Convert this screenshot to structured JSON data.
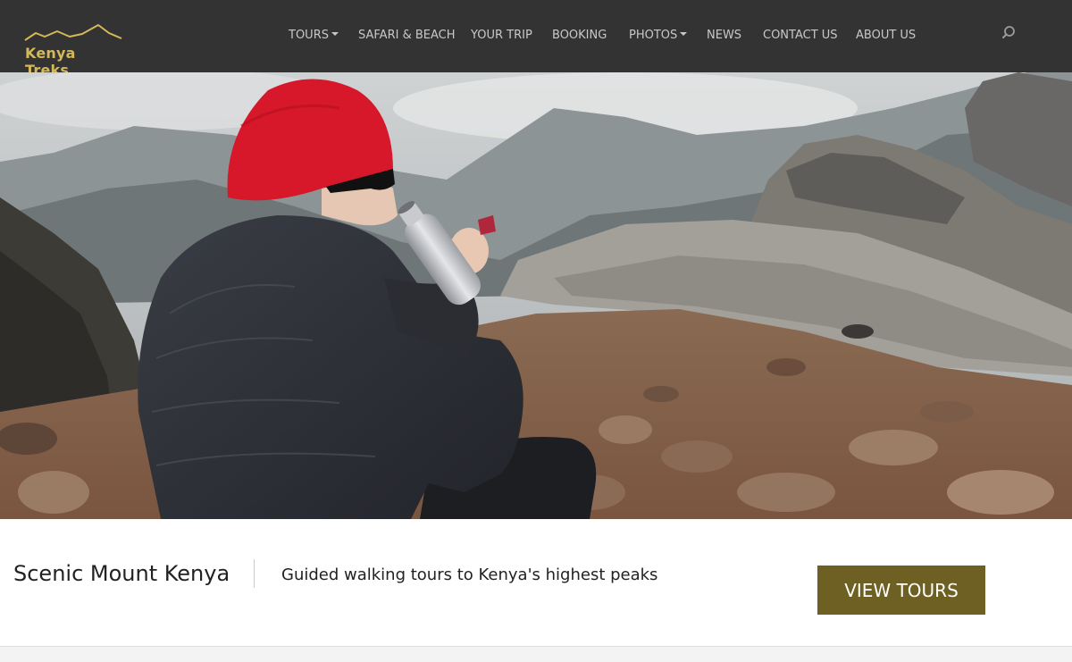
{
  "brand": {
    "name": "Kenya Treks"
  },
  "nav": {
    "items": [
      {
        "label": "TOURS",
        "dropdown": true
      },
      {
        "label": "SAFARI & BEACH",
        "dropdown": false
      },
      {
        "label": "YOUR TRIP",
        "dropdown": false
      },
      {
        "label": "BOOKING",
        "dropdown": false
      },
      {
        "label": "PHOTOS",
        "dropdown": true
      },
      {
        "label": "NEWS",
        "dropdown": false
      },
      {
        "label": "CONTACT US",
        "dropdown": false
      },
      {
        "label": "ABOUT US",
        "dropdown": false
      }
    ],
    "search_icon": "search-icon"
  },
  "hero": {
    "image": "hiker-in-red-beanie-drinking-from-bottle-on-rocky-mountain-summit"
  },
  "info": {
    "title": "Scenic Mount Kenya",
    "tagline": "Guided walking tours to Kenya's highest peaks",
    "cta_label": "VIEW TOURS"
  },
  "colors": {
    "header_bg": "#333333",
    "logo_gold": "#d4b85a",
    "cta_bg": "#6e5f22",
    "nav_text": "#c8c8c8"
  }
}
